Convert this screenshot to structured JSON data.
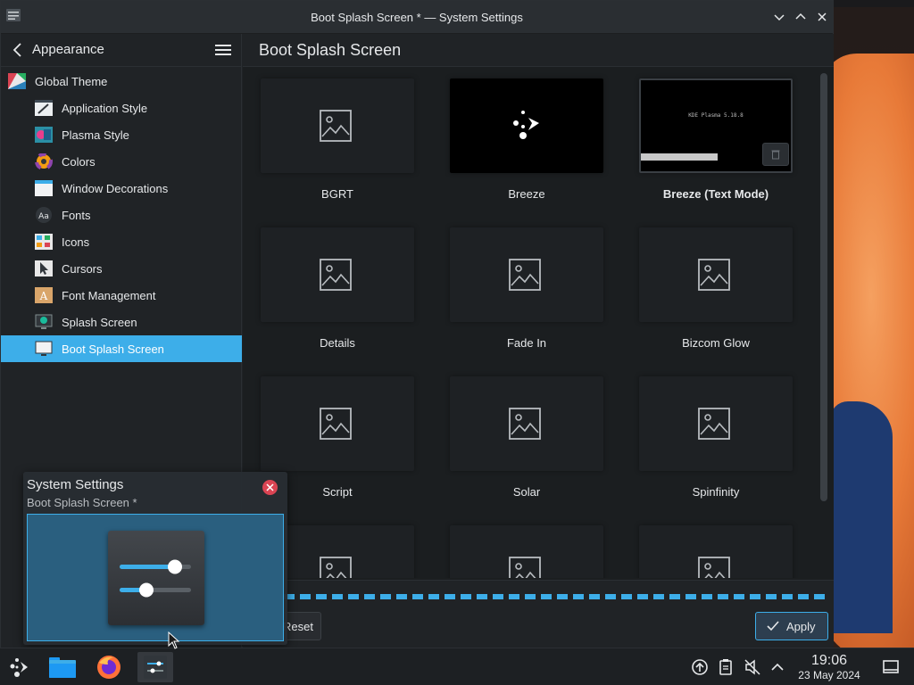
{
  "window": {
    "title": "Boot Splash Screen * — System Settings"
  },
  "sidebar": {
    "header_title": "Appearance",
    "items": [
      {
        "label": "Global Theme",
        "icon": "global-theme-icon"
      },
      {
        "label": "Application Style",
        "icon": "application-style-icon"
      },
      {
        "label": "Plasma Style",
        "icon": "plasma-style-icon"
      },
      {
        "label": "Colors",
        "icon": "colors-icon"
      },
      {
        "label": "Window Decorations",
        "icon": "window-decorations-icon"
      },
      {
        "label": "Fonts",
        "icon": "fonts-icon"
      },
      {
        "label": "Icons",
        "icon": "icons-icon"
      },
      {
        "label": "Cursors",
        "icon": "cursors-icon"
      },
      {
        "label": "Font Management",
        "icon": "font-management-icon"
      },
      {
        "label": "Splash Screen",
        "icon": "splash-screen-icon"
      },
      {
        "label": "Boot Splash Screen",
        "icon": "boot-splash-icon",
        "active": true
      }
    ]
  },
  "main": {
    "title": "Boot Splash Screen",
    "themes": [
      {
        "label": "BGRT"
      },
      {
        "label": "Breeze"
      },
      {
        "label": "Breeze (Text Mode)",
        "selected": true,
        "preview_text": "KDE Plasma 5.18.8"
      },
      {
        "label": "Details"
      },
      {
        "label": "Fade In"
      },
      {
        "label": "Bizcom Glow"
      },
      {
        "label": "Script"
      },
      {
        "label": "Solar"
      },
      {
        "label": "Spinfinity"
      },
      {
        "label": ""
      },
      {
        "label": ""
      },
      {
        "label": ""
      }
    ]
  },
  "footer": {
    "reset_label": "Reset",
    "apply_label": "Apply"
  },
  "tooltip": {
    "title": "System Settings",
    "subtitle": "Boot Splash Screen *"
  },
  "taskbar": {
    "time": "19:06",
    "date": "23 May 2024"
  },
  "colors": {
    "accent": "#3daee9",
    "window_bg": "#202326",
    "close_red": "#da4453"
  }
}
